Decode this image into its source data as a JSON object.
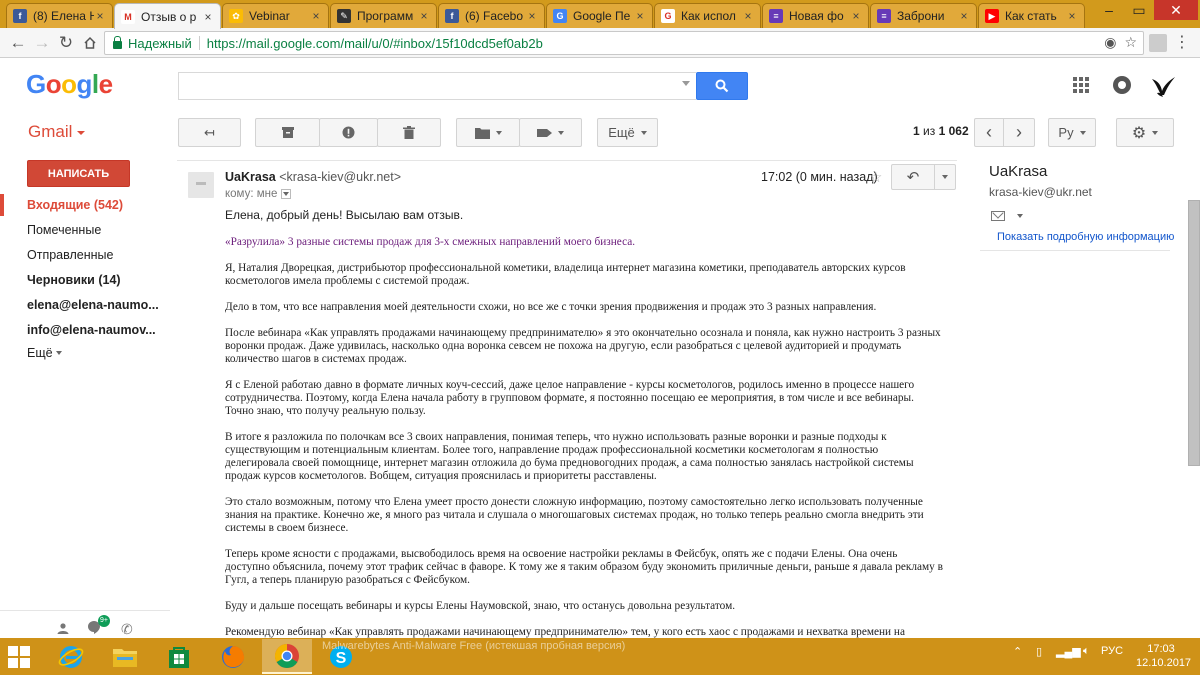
{
  "browser": {
    "tabs": [
      {
        "title": "(8) Елена Н",
        "favicon_color": "#3b5998",
        "favicon_glyph": "f",
        "active": false
      },
      {
        "title": "Отзыв о р",
        "favicon_color": "#ffffff",
        "favicon_glyph": "M",
        "active": true
      },
      {
        "title": "Vebinar",
        "favicon_color": "#fbbc05",
        "favicon_glyph": "✿",
        "active": false
      },
      {
        "title": "Программ",
        "favicon_color": "#333333",
        "favicon_glyph": "✎",
        "active": false
      },
      {
        "title": "(6) Facebo",
        "favicon_color": "#3b5998",
        "favicon_glyph": "f",
        "active": false
      },
      {
        "title": "Google Пе",
        "favicon_color": "#4285f4",
        "favicon_glyph": "G",
        "active": false
      },
      {
        "title": "Как испол",
        "favicon_color": "#ffffff",
        "favicon_glyph": "G",
        "active": false
      },
      {
        "title": "Новая фо",
        "favicon_color": "#673ab7",
        "favicon_glyph": "≡",
        "active": false
      },
      {
        "title": "Заброни",
        "favicon_color": "#673ab7",
        "favicon_glyph": "≡",
        "active": false
      },
      {
        "title": "Как стать",
        "favicon_color": "#ff0000",
        "favicon_glyph": "▶",
        "active": false
      }
    ],
    "address": {
      "secure_label": "Надежный",
      "url": "https://mail.google.com/mail/u/0/#inbox/15f10dcd5ef0ab2b"
    }
  },
  "gmail": {
    "logo_letters": [
      "G",
      "o",
      "o",
      "g",
      "l",
      "e"
    ],
    "search_placeholder": "",
    "app_label": "Gmail",
    "toolbar": {
      "more_label": "Ещё",
      "pager_position": "1",
      "pager_of": "из",
      "pager_total": "1 062",
      "lang_label": "Ру"
    },
    "sidebar": {
      "compose_label": "НАПИСАТЬ",
      "items": [
        {
          "label": "Входящие (542)",
          "style": "active"
        },
        {
          "label": "Помеченные",
          "style": "normal"
        },
        {
          "label": "Отправленные",
          "style": "normal"
        },
        {
          "label": "Черновики (14)",
          "style": "bold"
        },
        {
          "label": "elena@elena-naumo...",
          "style": "bold"
        },
        {
          "label": "info@elena-naumov...",
          "style": "bold"
        },
        {
          "label": "Ещё",
          "style": "more"
        }
      ],
      "hangouts_badge": "9+"
    },
    "message": {
      "sender_name": "UaKrasa",
      "sender_email": "<krasa-kiev@ukr.net>",
      "to_line": "кому: мне",
      "time": "17:02 (0 мин. назад)",
      "greeting": "Елена, добрый день! Высылаю вам отзыв.",
      "headline": "«Разрулила» 3 разные системы продаж для 3-х смежных направлений моего бизнеса.",
      "paragraphs": [
        "Я, Наталия Дворецкая, дистрибьютор профессиональной кометики, владелица интернет магазина кометики, преподаватель авторских курсов косметологов имела проблемы с системой продаж.",
        "Дело в том, что все направления моей деятельности схожи, но все же с точки зрения продвижения и продаж это 3 разных направления.",
        "После вебинара «Как управлять продажами начинающему предпринимателю» я это окончательно осознала и поняла, как нужно настроить 3 разных воронки продаж. Даже удивилась, насколько одна воронка севсем не похожа на другую, если разобраться с целевой аудиторией и продумать количество шагов в системах продаж.",
        "Я с Еленой работаю давно в формате личных коуч-сессий, даже целое направление - курсы косметологов, родилось именно в процессе нашего сотрудничества. Поэтому, когда Елена начала работу в групповом формате, я постоянно посещаю ее мероприятия, в том числе и все вебинары. Точно знаю, что получу реальную пользу.",
        "В итоге я разложила по полочкам все 3 своих направления, понимая теперь, что нужно использовать разные воронки и разные подходы к существующим и потенциальным клиентам. Более того, направление продаж профессиональной косметики косметологам я полностью делегировала своей помощнице, интернет магазин отложила до бума предновогодних продаж, а сама полностью занялась настройкой системы продаж курсов косметологов. Вобщем, ситуация прояснилась и приоритеты расставлены.",
        "Это стало возможным, потому что Елена умеет просто донести сложную информацию, поэтому самостоятельно легко использовать полученные знания на практике. Конечно же, я много раз читала и слушала о многошаговых системах продаж, но только теперь реально смогла внедрить эти системы в своем бизнесе.",
        "Теперь кроме ясности с продажами, высвободилось время на освоение настройки рекламы в Фейсбук, опять же с подачи Елены. Она очень доступно объяснила, почему этот трафик сейчас в фаворе. К тому же я таким образом буду экономить приличные деньги, раньше я давала рекламу в Гугл, а теперь планирую разобраться с Фейсбуком.",
        "Буду и дальше посещать вебинары и курсы Елены Наумовской, знаю, что останусь довольна результатом.",
        "Рекомендую вебинар «Как управлять продажами начинающему предпринимателю» тем, у кого есть хаос с продажами и нехватка времени на освоение других современных способов продаж."
      ]
    },
    "contact_panel": {
      "name": "UaKrasa",
      "email": "krasa-kiev@ukr.net",
      "details_link": "Показать подробную информацию"
    }
  },
  "taskbar": {
    "ghost_text": "Malwarebytes Anti-Malware Free (истекшая пробная версия)",
    "language": "РУС",
    "time": "17:03",
    "date": "12.10.2017"
  },
  "colors": {
    "accent_red": "#dd4b39",
    "compose_red": "#d14836",
    "search_blue": "#4285f4",
    "taskbar": "#cf9218",
    "tabstrip": "#d29a1c"
  }
}
